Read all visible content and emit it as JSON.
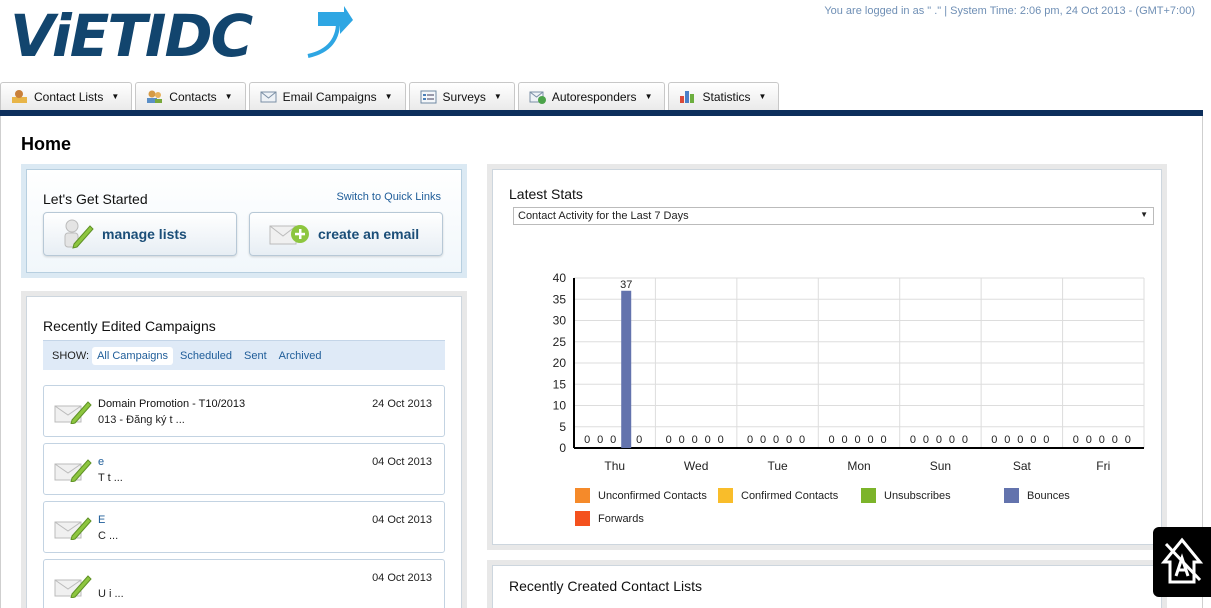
{
  "header": {
    "logo_text": "ViETIDC",
    "user_info": "You are logged in as \"          .\" | System Time: 2:06 pm, 24 Oct 2013 - (GMT+7:00)"
  },
  "nav": {
    "tabs": [
      {
        "label": "Contact Lists",
        "icon": "contact-lists-icon"
      },
      {
        "label": "Contacts",
        "icon": "contacts-icon"
      },
      {
        "label": "Email Campaigns",
        "icon": "email-icon"
      },
      {
        "label": "Surveys",
        "icon": "surveys-icon"
      },
      {
        "label": "Autoresponders",
        "icon": "autoresponder-icon"
      },
      {
        "label": "Statistics",
        "icon": "statistics-icon"
      }
    ]
  },
  "page": {
    "title": "Home"
  },
  "get_started": {
    "title": "Let's Get Started",
    "quick_links": "Switch to Quick Links",
    "manage_lists": "manage lists",
    "create_email": "create an email"
  },
  "recent_campaigns": {
    "title": "Recently Edited Campaigns",
    "show_label": "SHOW:",
    "filters": [
      "All Campaigns",
      "Scheduled",
      "Sent",
      "Archived"
    ],
    "items": [
      {
        "name": "Domain Promotion - T10/2013",
        "sub": "              013 - Đăng ký t ...",
        "date": "24 Oct 2013"
      },
      {
        "name": "                       e",
        "sub": "T                     t ...",
        "date": "04 Oct 2013"
      },
      {
        "name": "E                ",
        "sub": "C                          ...",
        "date": "04 Oct 2013"
      },
      {
        "name": "                 ",
        "sub": "U                          i ...",
        "date": "04 Oct 2013"
      }
    ]
  },
  "latest_stats": {
    "title": "Latest Stats",
    "select_value": "Contact Activity for the Last 7 Days"
  },
  "chart_data": {
    "type": "bar",
    "categories": [
      "Thu",
      "Wed",
      "Tue",
      "Mon",
      "Sun",
      "Sat",
      "Fri"
    ],
    "series": [
      {
        "name": "Unconfirmed Contacts",
        "color": "#f58a2a",
        "values": [
          0,
          0,
          0,
          0,
          0,
          0,
          0
        ]
      },
      {
        "name": "Confirmed Contacts",
        "color": "#f9bd2a",
        "values": [
          0,
          0,
          0,
          0,
          0,
          0,
          0
        ]
      },
      {
        "name": "Unsubscribes",
        "color": "#7cb42a",
        "values": [
          0,
          0,
          0,
          0,
          0,
          0,
          0
        ]
      },
      {
        "name": "Bounces",
        "color": "#6373ad",
        "values": [
          37,
          0,
          0,
          0,
          0,
          0,
          0
        ]
      },
      {
        "name": "Forwards",
        "color": "#f4511e",
        "values": [
          0,
          0,
          0,
          0,
          0,
          0,
          0
        ]
      }
    ],
    "yticks": [
      0,
      5,
      10,
      15,
      20,
      25,
      30,
      35,
      40
    ],
    "ylim": [
      0,
      40
    ],
    "grid": true,
    "legend_position": "bottom"
  },
  "recent_contacts": {
    "title": "Recently Created Contact Lists"
  }
}
